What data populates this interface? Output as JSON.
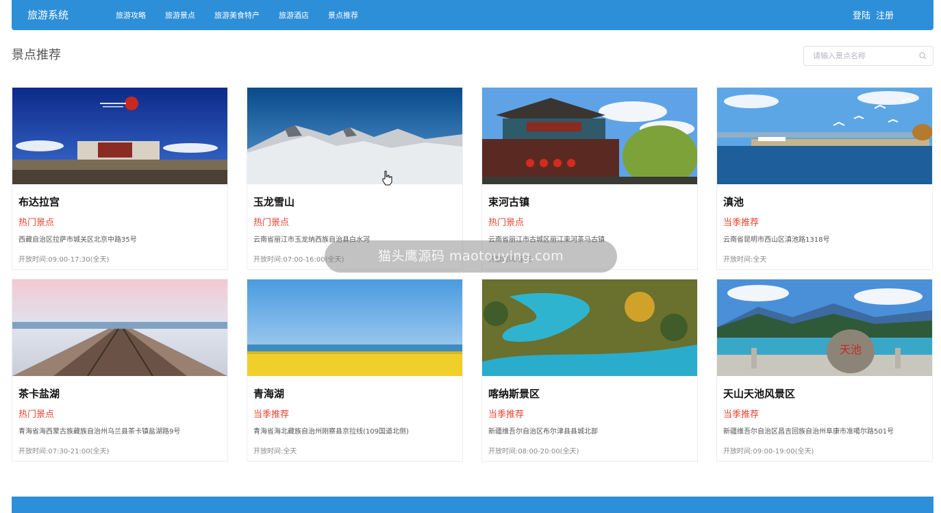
{
  "header": {
    "brand": "旅游系统",
    "nav": [
      "旅游攻略",
      "旅游景点",
      "旅游美食特产",
      "旅游酒店",
      "景点推荐"
    ],
    "login": "登陆",
    "register": "注册"
  },
  "page": {
    "title": "景点推荐",
    "search_placeholder": "请输入景点名称"
  },
  "spots": [
    {
      "name": "布达拉宫",
      "tag": "热门景点",
      "address": "西藏自治区拉萨市城关区北京中路35号",
      "hours": "开放时间:09:00-17:30(全天)",
      "image": "potala"
    },
    {
      "name": "玉龙雪山",
      "tag": "热门景点",
      "address": "云南省丽江市玉龙纳西族自治县白水河",
      "hours": "开放时间:07:00-16:00(全天)",
      "image": "snow-mountain"
    },
    {
      "name": "束河古镇",
      "tag": "热门景点",
      "address": "云南省丽江市古城区丽江束河茶马古镇",
      "hours": "开放时间:全天",
      "image": "old-town-gate"
    },
    {
      "name": "滇池",
      "tag": "当季推荐",
      "address": "云南省昆明市西山区滇池路1318号",
      "hours": "开放时间:全天",
      "image": "lake-gulls"
    },
    {
      "name": "茶卡盐湖",
      "tag": "热门景点",
      "address": "青海省海西蒙古族藏族自治州乌兰县茶卡镇盐湖路9号",
      "hours": "开放时间:07:30-21:00(全天)",
      "image": "salt-lake"
    },
    {
      "name": "青海湖",
      "tag": "当季推荐",
      "address": "青海省海北藏族自治州刚察县京拉线(109国道北侧)",
      "hours": "开放时间:全天",
      "image": "rapeseed-lake"
    },
    {
      "name": "喀纳斯景区",
      "tag": "当季推荐",
      "address": "新疆维吾尔自治区布尔津县县城北部",
      "hours": "开放时间:08:00-20:00(全天)",
      "image": "river-forest"
    },
    {
      "name": "天山天池风景区",
      "tag": "当季推荐",
      "address": "新疆维吾尔自治区昌吉回族自治州阜康市准噶尔路501号",
      "hours": "开放时间:09:00-19:00(全天)",
      "image": "mountain-lake-stone"
    }
  ],
  "watermark": "猫头鹰源码 maotouying.com",
  "colors": {
    "primary": "#2d8fd8",
    "tag": "#e8432f"
  }
}
